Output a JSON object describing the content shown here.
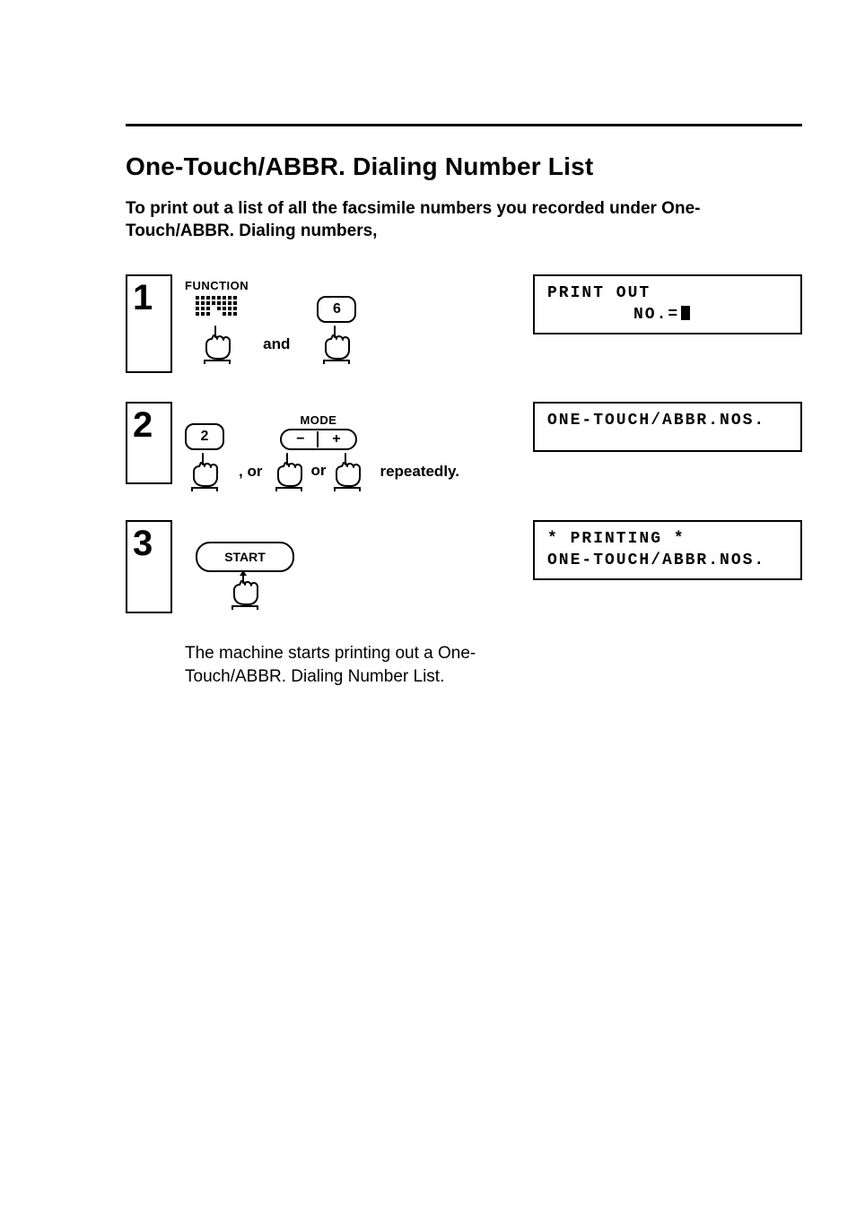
{
  "title": "One-Touch/ABBR. Dialing Number List",
  "intro": "To print out a list of all the facsimile numbers you recorded under One-Touch/ABBR. Dialing numbers,",
  "steps": {
    "s1": {
      "num": "1",
      "function_label": "FUNCTION",
      "and": "and",
      "key6": "6",
      "display_line1": "PRINT OUT",
      "display_line2_prefix": "NO.="
    },
    "s2": {
      "num": "2",
      "key2": "2",
      "mode_label": "MODE",
      "minus": "−",
      "plus": "+",
      "comma_or": ", or",
      "or": "or",
      "repeatedly": "repeatedly.",
      "display_line1": "ONE-TOUCH/ABBR.NOS."
    },
    "s3": {
      "num": "3",
      "start_label": "START",
      "display_line1": "* PRINTING *",
      "display_line2": "ONE-TOUCH/ABBR.NOS."
    }
  },
  "result": "The machine starts printing out a One-Touch/ABBR. Dialing Number List."
}
